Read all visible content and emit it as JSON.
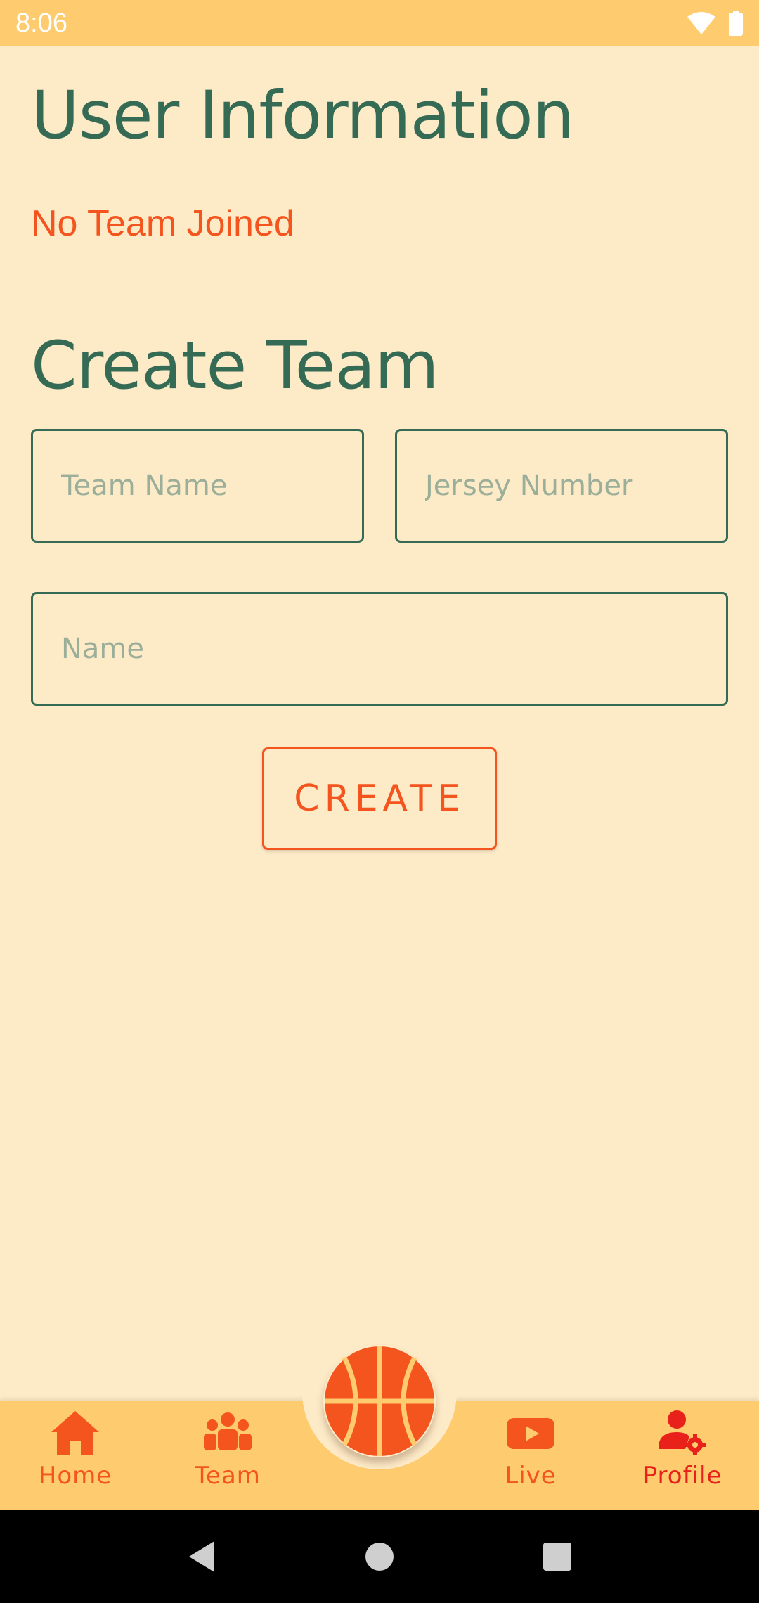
{
  "status_bar": {
    "time": "8:06",
    "wifi_icon": "wifi-icon",
    "battery_icon": "battery-icon"
  },
  "main": {
    "title": "User Information",
    "team_status": "No Team Joined",
    "create_title": "Create Team",
    "fields": {
      "team_name_placeholder": "Team Name",
      "jersey_placeholder": "Jersey Number",
      "name_placeholder": "Name"
    },
    "create_button": "CREATE"
  },
  "bottom_nav": {
    "items": [
      {
        "label": "Home",
        "icon": "home-icon"
      },
      {
        "label": "Team",
        "icon": "team-icon"
      },
      {
        "label": "Live",
        "icon": "youtube-icon"
      },
      {
        "label": "Profile",
        "icon": "profile-settings-icon",
        "active": true
      }
    ],
    "center_button_icon": "basketball-icon"
  },
  "colors": {
    "background": "#FDEAC7",
    "header_bar": "#FECB6E",
    "primary_green": "#356B55",
    "accent_orange": "#F4541E",
    "active_red": "#E8221B"
  }
}
